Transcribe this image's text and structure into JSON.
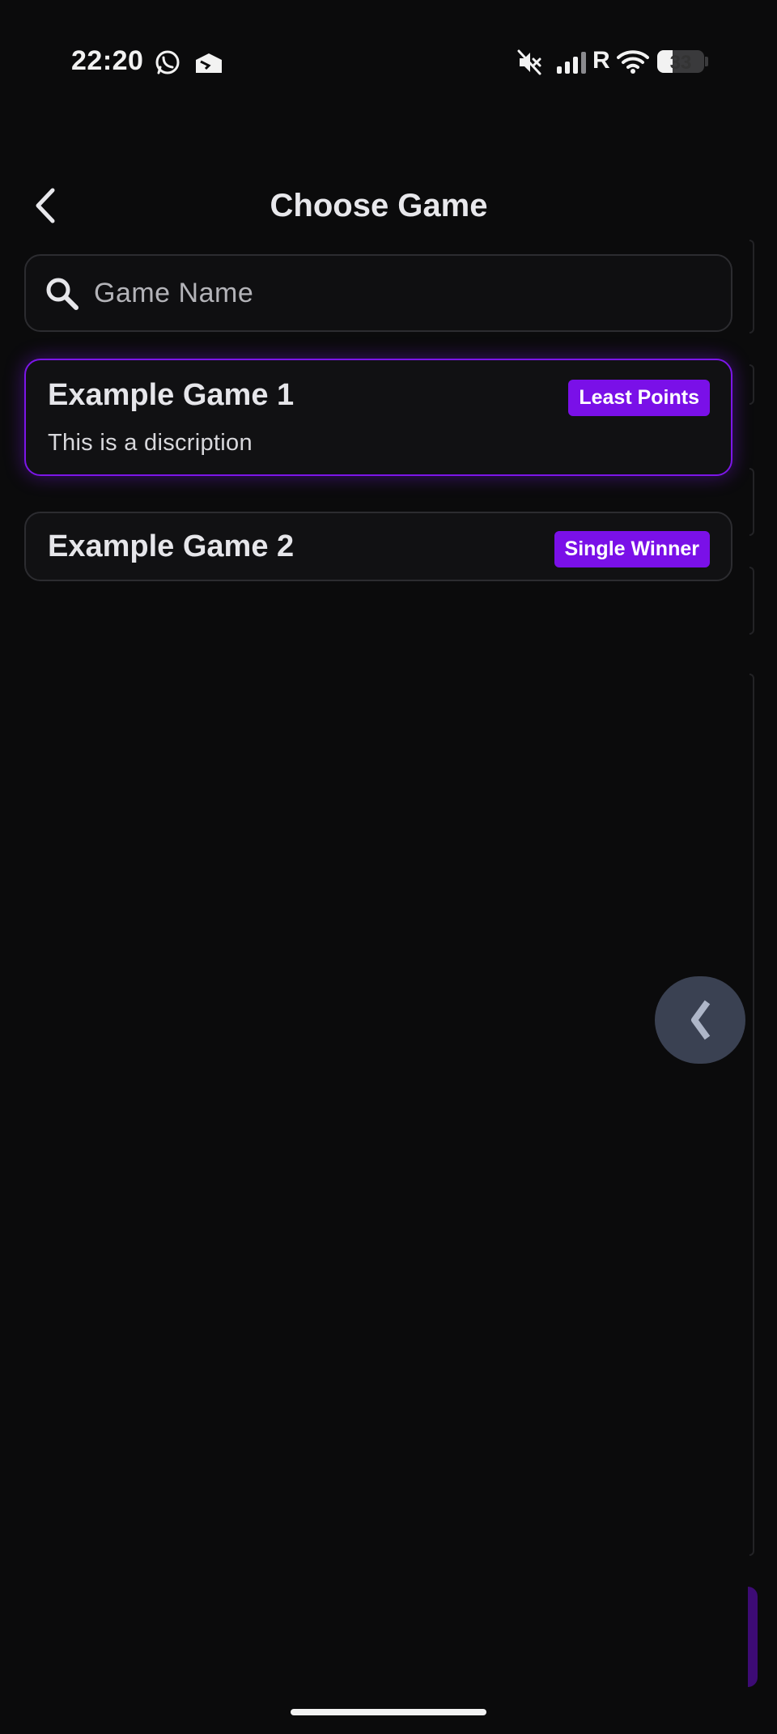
{
  "status_bar": {
    "time": "22:20",
    "icons": [
      "whatsapp-icon",
      "mail-icon",
      "mute-icon",
      "signal-icon",
      "wifi-icon"
    ],
    "network_label": "R",
    "battery_level": "33"
  },
  "header": {
    "back_icon": "chevron-left-icon",
    "title": "Choose Game"
  },
  "search": {
    "icon": "search-icon",
    "placeholder": "Game Name",
    "value": ""
  },
  "games": [
    {
      "name": "Example Game 1",
      "badge": "Least Points",
      "description": "This is a discription",
      "selected": true
    },
    {
      "name": "Example Game 2",
      "badge": "Single Winner",
      "selected": false
    }
  ],
  "side_panel": {
    "toggle_icon": "chevron-left-icon"
  },
  "colors": {
    "background": "#0b0b0c",
    "accent": "#7a10e8",
    "card_border": "#2c2c30",
    "side_button": "#3a4152"
  }
}
